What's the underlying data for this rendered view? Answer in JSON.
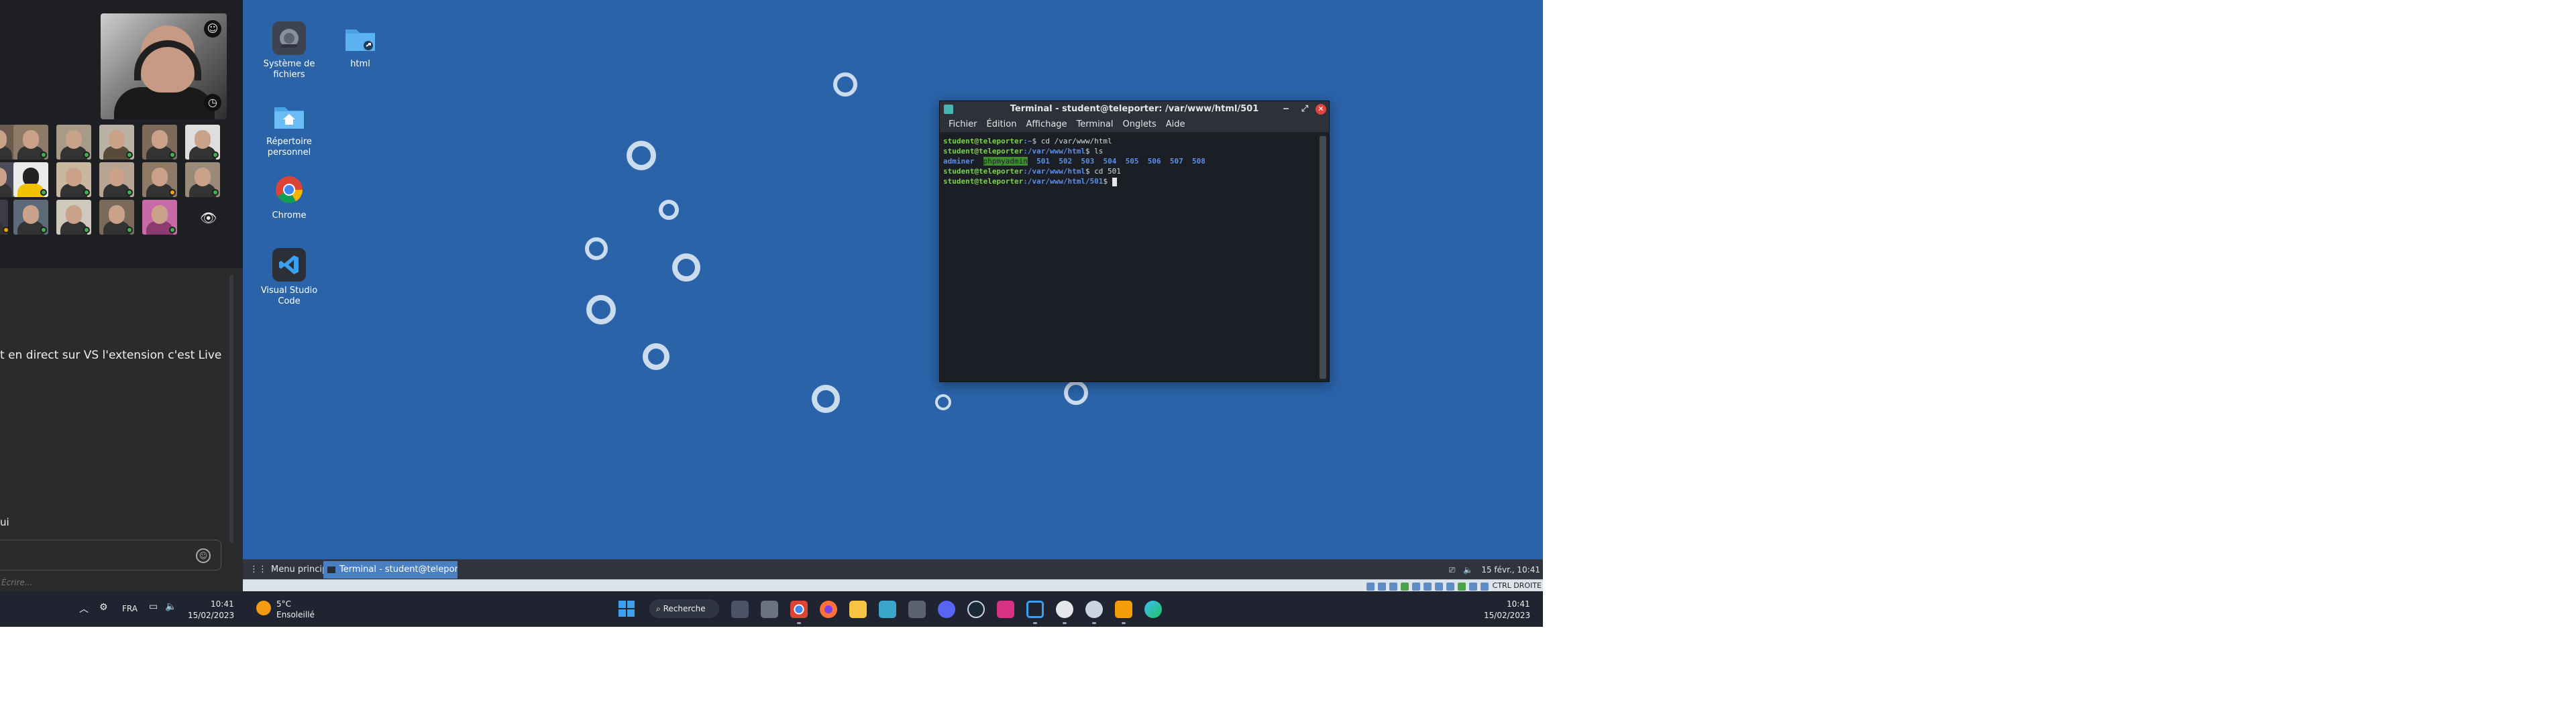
{
  "chat": {
    "message": "t en direct sur VS l'extension c'est Live",
    "user_fragment": "ui",
    "input_placeholder": "Écrire..."
  },
  "desktop_icons": [
    {
      "label_line1": "Système de",
      "label_line2": "fichiers",
      "icon": "disk-icon"
    },
    {
      "label_line1": "html",
      "label_line2": "",
      "icon": "folder-link-icon"
    },
    {
      "label_line1": "Répertoire",
      "label_line2": "personnel",
      "icon": "home-folder-icon"
    },
    {
      "label_line1": "Chrome",
      "label_line2": "",
      "icon": "chrome-icon"
    },
    {
      "label_line1": "Visual Studio",
      "label_line2": "Code",
      "icon": "vscode-icon"
    }
  ],
  "terminal": {
    "title": "Terminal - student@teleporter: /var/www/html/501",
    "menu": [
      "Fichier",
      "Édition",
      "Affichage",
      "Terminal",
      "Onglets",
      "Aide"
    ],
    "lines": [
      {
        "user": "student@teleporter",
        "path": ":~",
        "cmd": "$ cd /var/www/html"
      },
      {
        "user": "student@teleporter",
        "path": ":/var/www/html",
        "cmd": "$ ls"
      },
      {
        "listing": [
          "adminer",
          "phpmyadmin",
          "501",
          "502",
          "503",
          "504",
          "505",
          "506",
          "507",
          "508"
        ]
      },
      {
        "user": "student@teleporter",
        "path": ":/var/www/html",
        "cmd": "$ cd 501"
      },
      {
        "user": "student@teleporter",
        "path": ":/var/www/html/501",
        "cmd": "$ "
      }
    ]
  },
  "vm_panel": {
    "menu_label": "Menu principal",
    "task_label": "Terminal - student@teleport...",
    "clock": "15 févr., 10:41",
    "host_key": "CTRL DROITE"
  },
  "win_taskbar": {
    "lang": "FRA",
    "left_time": "10:41",
    "left_date": "15/02/2023",
    "weather_temp": "5°C",
    "weather_desc": "Ensoleillé",
    "search_label": "Recherche",
    "right_time": "10:41",
    "right_date": "15/02/2023"
  }
}
